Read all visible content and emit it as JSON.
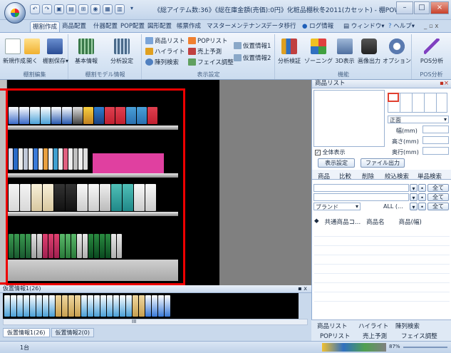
{
  "window": {
    "title": "《総アイテム数:36》《総在庫金額(売価):0円》化粧品棚秋冬2011(カセット) - 棚POWER",
    "controls": [
      "–",
      "□",
      "×"
    ]
  },
  "qat": {
    "items": [
      "↶",
      "↷",
      "▣",
      "▤",
      "⊞",
      "◉",
      "▦",
      "▥",
      "▾"
    ]
  },
  "tabs": [
    "棚割作成",
    "商品配置",
    "什器配置",
    "POP配置",
    "図形配置",
    "帳票作成",
    "マスターメンテナンス",
    "データ移行"
  ],
  "tabs_right": [
    "ログ情報",
    "ウィンドウ",
    "ヘルプ"
  ],
  "ribbon": {
    "group1": {
      "label": "棚割編集",
      "buttons": [
        "新規作成",
        "開く",
        "棚割保存"
      ]
    },
    "group2": {
      "label": "棚割モデル情報",
      "buttons": [
        "基本情報",
        "分析設定"
      ]
    },
    "group3": {
      "label": "表示設定",
      "small": [
        "商品リスト",
        "POPリスト",
        "ハイライト",
        "売上予測",
        "陳列検索",
        "フェイス調整",
        "仮置情報1",
        "仮置情報2"
      ]
    },
    "group4": {
      "label": "機能",
      "buttons": [
        "分析検証",
        "ゾーニング",
        "3D表示",
        "画像出力",
        "オプション"
      ]
    },
    "group5": {
      "label": "POS分析",
      "buttons": [
        "POS分析"
      ]
    }
  },
  "bottom": {
    "panel_title": "仮置情報1(26)",
    "pin": "▪ x",
    "tabs": [
      "仮置情報1(26)",
      "仮置情報2(0)"
    ],
    "scroll_mark": "III"
  },
  "status": {
    "count": "1台",
    "zoom": "87%"
  },
  "right": {
    "title": "商品リスト",
    "face_select": "正面",
    "fields": {
      "width": "幅(mm)",
      "height": "高さ(mm)",
      "depth": "奥行(mm)"
    },
    "show_all": "全体表示",
    "buttons": {
      "display_settings": "表示設定",
      "file_output": "ファイル出力"
    },
    "tabs": [
      "商品",
      "比較",
      "削除",
      "絞込検索",
      "単品検索"
    ],
    "filter_all": "全て",
    "brand": "ブランド",
    "brand_value": "ALL (...",
    "columns": [
      "◆",
      "共通商品コ...",
      "商品名",
      "商品(幅)"
    ],
    "bottom_tabs_row1": [
      "商品リスト",
      "ハイライト",
      "陳列検索"
    ],
    "bottom_tabs_row2": [
      "POPリスト",
      "売上予測",
      "フェイス調整"
    ]
  }
}
